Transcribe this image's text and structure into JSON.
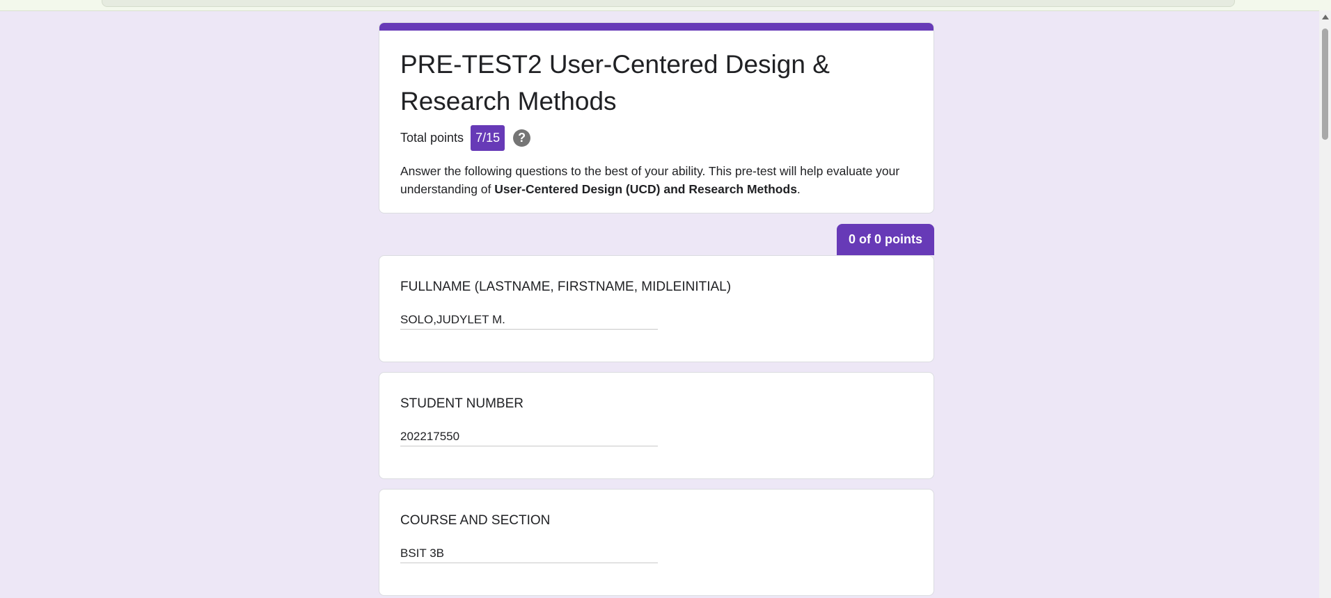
{
  "form": {
    "title": "PRE-TEST2 User-Centered Design & Research Methods",
    "total_points_label": "Total points",
    "score": "7/15",
    "help_symbol": "?",
    "description_part1": " Answer the following questions to the best of your ability. This pre-test will help evaluate your understanding of ",
    "description_bold": "User-Centered Design (UCD) and Research Methods",
    "description_part2": ".",
    "accent_color": "#673ab7",
    "background_color": "#ede7f6"
  },
  "section": {
    "points_label": "0 of 0 points"
  },
  "questions": [
    {
      "title": "FULLNAME (LASTNAME, FIRSTNAME, MIDLEINITIAL)",
      "answer": "SOLO,JUDYLET M."
    },
    {
      "title": "STUDENT NUMBER",
      "answer": "202217550"
    },
    {
      "title": "COURSE AND SECTION",
      "answer": "BSIT 3B"
    }
  ]
}
